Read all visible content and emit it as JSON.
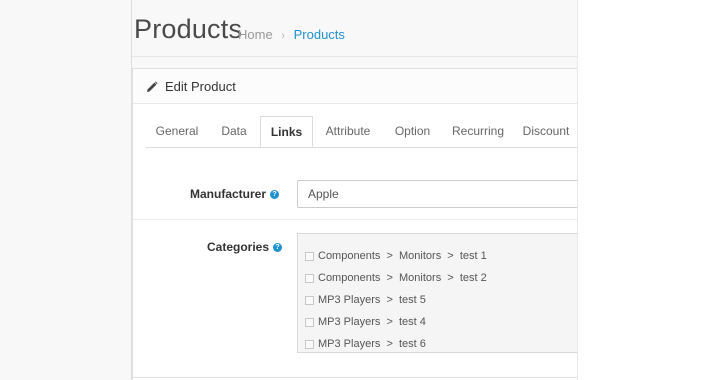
{
  "header": {
    "title": "Products",
    "breadcrumb": {
      "home": "Home",
      "separator": "›",
      "current": "Products"
    }
  },
  "panel": {
    "icon": "pencil-icon",
    "title": "Edit Product"
  },
  "tabs": [
    {
      "label": "General",
      "active": false
    },
    {
      "label": "Data",
      "active": false
    },
    {
      "label": "Links",
      "active": true
    },
    {
      "label": "Attribute",
      "active": false
    },
    {
      "label": "Option",
      "active": false
    },
    {
      "label": "Recurring",
      "active": false
    },
    {
      "label": "Discount",
      "active": false
    }
  ],
  "form": {
    "manufacturer": {
      "label": "Manufacturer",
      "help_icon": "question-circle-icon",
      "value": "Apple"
    },
    "categories": {
      "label": "Categories",
      "help_icon": "question-circle-icon",
      "items": [
        {
          "label": "Components  >  Monitors  >  test 1",
          "checked": false
        },
        {
          "label": "Components  >  Monitors  >  test 2",
          "checked": false
        },
        {
          "label": "MP3 Players  >  test 5",
          "checked": false
        },
        {
          "label": "MP3 Players  >  test 4",
          "checked": false
        },
        {
          "label": "MP3 Players  >  test 6",
          "checked": false
        }
      ]
    }
  },
  "colors": {
    "link": "#1e91cf",
    "help_icon": "#1e91cf",
    "background": "#f8f8f8"
  }
}
